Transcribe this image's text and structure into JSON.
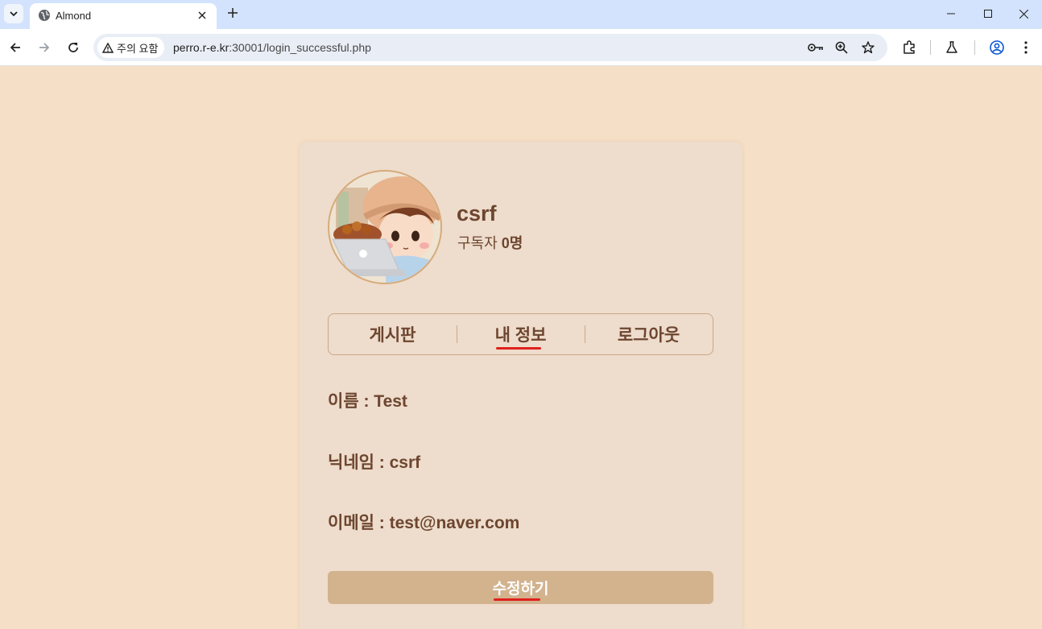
{
  "browser": {
    "tab_title": "Almond",
    "security_label": "주의 요함",
    "url_host": "perro.r-e.kr",
    "url_rest": ":30001/login_successful.php"
  },
  "profile": {
    "username": "csrf",
    "subscribers_label": "구독자",
    "subscribers_count": "0명"
  },
  "menu": {
    "items": [
      {
        "label": "게시판"
      },
      {
        "label": "내 정보"
      },
      {
        "label": "로그아웃"
      }
    ],
    "active_index": 1
  },
  "info": {
    "name": "이름 : Test",
    "nickname": "닉네임 : csrf",
    "email": "이메일 : test@naver.com"
  },
  "actions": {
    "edit_label": "수정하기"
  },
  "colors": {
    "page_bg": "#f5dfc6",
    "card_bg": "#eedccc",
    "text_brown": "#6d4630",
    "button_bg": "#d2b38e",
    "annotation_red": "#e0201c"
  },
  "icons": [
    "tab-list-icon",
    "globe-icon",
    "close-icon",
    "plus-icon",
    "minimize-icon",
    "maximize-icon",
    "back-icon",
    "forward-icon",
    "reload-icon",
    "warning-icon",
    "key-icon",
    "zoom-icon",
    "star-icon",
    "extensions-icon",
    "labs-icon",
    "profile-icon",
    "menu-icon"
  ]
}
